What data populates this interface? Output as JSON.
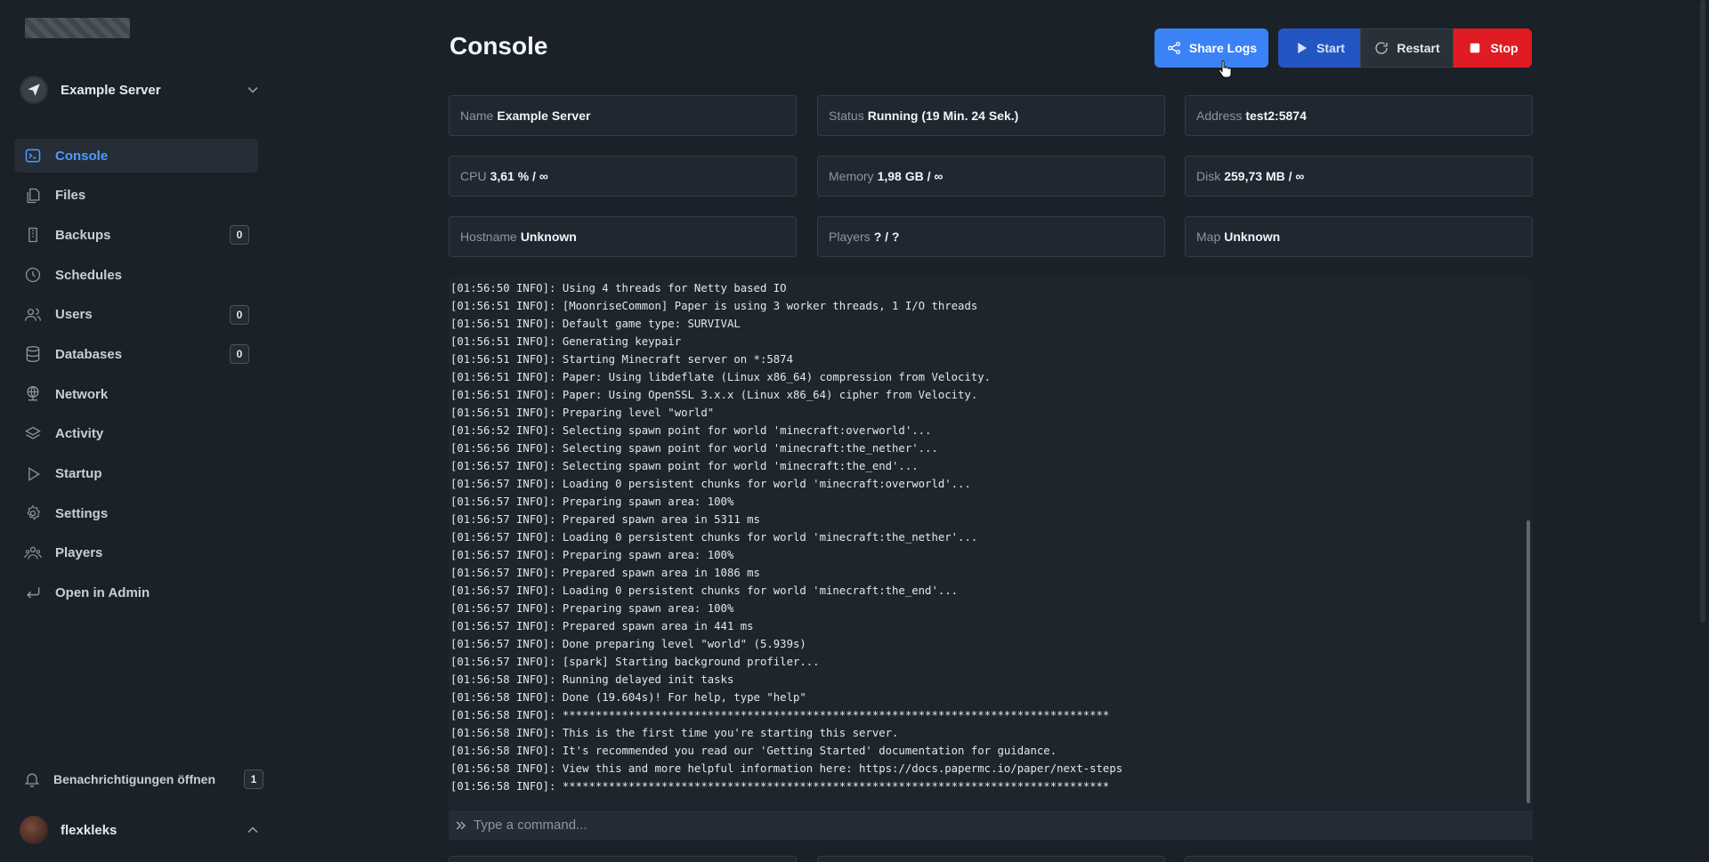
{
  "sidebar": {
    "server_name": "Example Server",
    "items": [
      {
        "label": "Console",
        "icon": "terminal-icon",
        "badge": null,
        "active": true
      },
      {
        "label": "Files",
        "icon": "files-icon",
        "badge": null
      },
      {
        "label": "Backups",
        "icon": "archive-icon",
        "badge": "0"
      },
      {
        "label": "Schedules",
        "icon": "clock-icon",
        "badge": null
      },
      {
        "label": "Users",
        "icon": "users-icon",
        "badge": "0"
      },
      {
        "label": "Databases",
        "icon": "database-icon",
        "badge": "0"
      },
      {
        "label": "Network",
        "icon": "network-icon",
        "badge": null
      },
      {
        "label": "Activity",
        "icon": "layers-icon",
        "badge": null
      },
      {
        "label": "Startup",
        "icon": "play-icon",
        "badge": null
      },
      {
        "label": "Settings",
        "icon": "gear-icon",
        "badge": null
      },
      {
        "label": "Players",
        "icon": "players-icon",
        "badge": null
      },
      {
        "label": "Open in Admin",
        "icon": "enter-icon",
        "badge": null
      }
    ],
    "notifications": {
      "label": "Benachrichtigungen öffnen",
      "count": "1"
    },
    "user": {
      "name": "flexkleks"
    }
  },
  "header": {
    "title": "Console",
    "share_label": "Share Logs",
    "start_label": "Start",
    "restart_label": "Restart",
    "stop_label": "Stop"
  },
  "stats": {
    "name": {
      "key": "Name",
      "value": "Example Server"
    },
    "status": {
      "key": "Status",
      "value": "Running (19 Min. 24 Sek.)"
    },
    "address": {
      "key": "Address",
      "value": "test2:5874"
    },
    "cpu": {
      "key": "CPU",
      "value": "3,61 % / ∞"
    },
    "memory": {
      "key": "Memory",
      "value": "1,98 GB / ∞"
    },
    "disk": {
      "key": "Disk",
      "value": "259,73 MB / ∞"
    },
    "hostname": {
      "key": "Hostname",
      "value": "Unknown"
    },
    "players": {
      "key": "Players",
      "value": "? / ?"
    },
    "map": {
      "key": "Map",
      "value": "Unknown"
    }
  },
  "console": {
    "lines": [
      "[01:56:50 INFO]: Using 4 threads for Netty based IO",
      "[01:56:51 INFO]: [MoonriseCommon] Paper is using 3 worker threads, 1 I/O threads",
      "[01:56:51 INFO]: Default game type: SURVIVAL",
      "[01:56:51 INFO]: Generating keypair",
      "[01:56:51 INFO]: Starting Minecraft server on *:5874",
      "[01:56:51 INFO]: Paper: Using libdeflate (Linux x86_64) compression from Velocity.",
      "[01:56:51 INFO]: Paper: Using OpenSSL 3.x.x (Linux x86_64) cipher from Velocity.",
      "[01:56:51 INFO]: Preparing level \"world\"",
      "[01:56:52 INFO]: Selecting spawn point for world 'minecraft:overworld'...",
      "[01:56:56 INFO]: Selecting spawn point for world 'minecraft:the_nether'...",
      "[01:56:57 INFO]: Selecting spawn point for world 'minecraft:the_end'...",
      "[01:56:57 INFO]: Loading 0 persistent chunks for world 'minecraft:overworld'...",
      "[01:56:57 INFO]: Preparing spawn area: 100%",
      "[01:56:57 INFO]: Prepared spawn area in 5311 ms",
      "[01:56:57 INFO]: Loading 0 persistent chunks for world 'minecraft:the_nether'...",
      "[01:56:57 INFO]: Preparing spawn area: 100%",
      "[01:56:57 INFO]: Prepared spawn area in 1086 ms",
      "[01:56:57 INFO]: Loading 0 persistent chunks for world 'minecraft:the_end'...",
      "[01:56:57 INFO]: Preparing spawn area: 100%",
      "[01:56:57 INFO]: Prepared spawn area in 441 ms",
      "[01:56:57 INFO]: Done preparing level \"world\" (5.939s)",
      "[01:56:57 INFO]: [spark] Starting background profiler...",
      "[01:56:58 INFO]: Running delayed init tasks",
      "[01:56:58 INFO]: Done (19.604s)! For help, type \"help\"",
      "[01:56:58 INFO]: ***********************************************************************************",
      "[01:56:58 INFO]: This is the first time you're starting this server.",
      "[01:56:58 INFO]: It's recommended you read our 'Getting Started' documentation for guidance.",
      "[01:56:58 INFO]: View this and more helpful information here: https://docs.papermc.io/paper/next-steps",
      "[01:56:58 INFO]: ***********************************************************************************"
    ],
    "command_placeholder": "Type a command..."
  },
  "colors": {
    "accent": "#3b82f6",
    "stop": "#e01b24",
    "active_nav": "#4b9dff",
    "background": "#1b2128"
  }
}
